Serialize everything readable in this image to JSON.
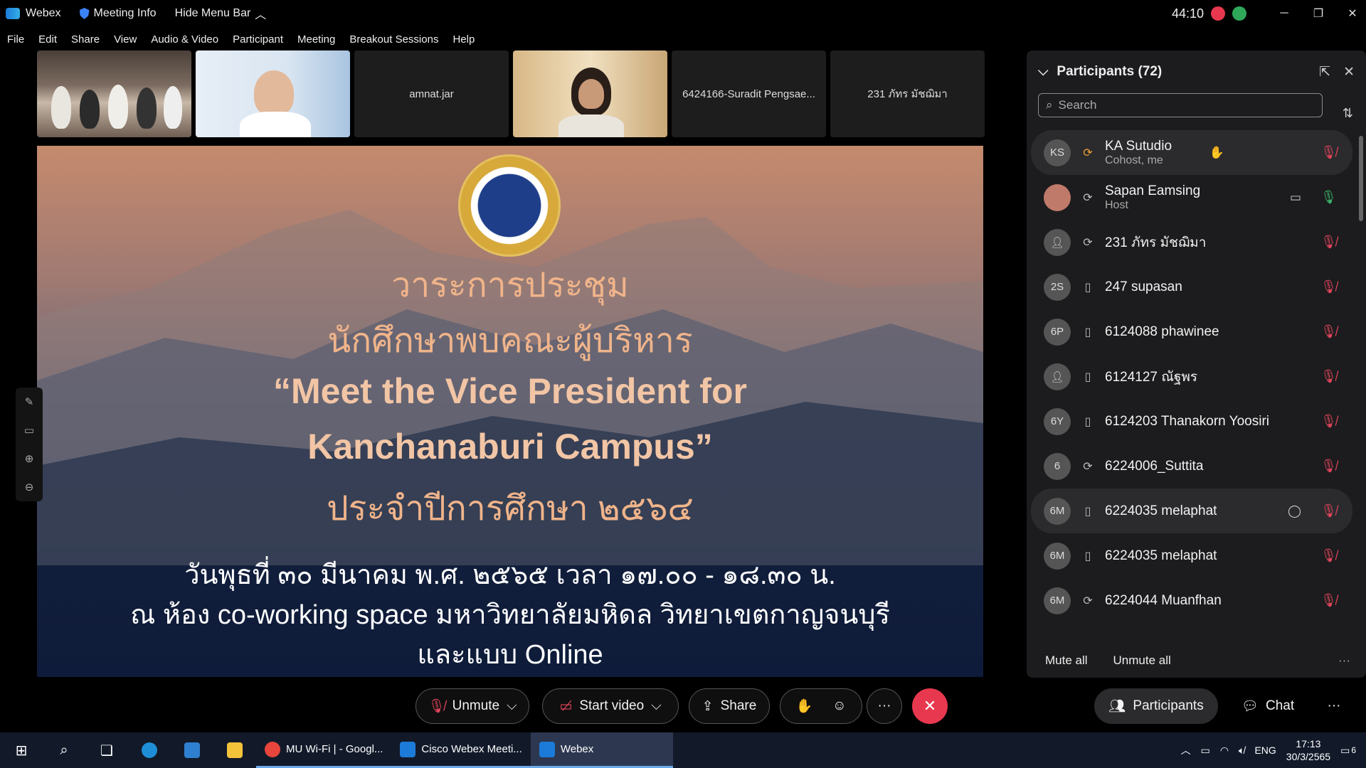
{
  "titlebar": {
    "app_name": "Webex",
    "meeting_info": "Meeting Info",
    "hide_menu_bar": "Hide Menu Bar",
    "timer": "44:10",
    "minimize": "─",
    "restore": "❐",
    "close": "✕"
  },
  "menubar": [
    "File",
    "Edit",
    "Share",
    "View",
    "Audio & Video",
    "Participant",
    "Meeting",
    "Breakout Sessions",
    "Help"
  ],
  "thumbnails": [
    {
      "label": ""
    },
    {
      "label": ""
    },
    {
      "label": "amnat.jar"
    },
    {
      "label": ""
    },
    {
      "label": "6424166-Suradit Pengsae..."
    },
    {
      "label": "231 ภัทร มัชฌิมา"
    }
  ],
  "slide": {
    "line1": "วาระการประชุม",
    "line2": "นักศึกษาพบคณะผู้บริหาร",
    "line3": "“Meet the Vice President for",
    "line4": "Kanchanaburi Campus”",
    "line5": "ประจำปีการศึกษา ๒๕๖๔",
    "line6": "วันพุธที่ ๓๐ มีนาคม พ.ศ. ๒๕๖๕ เวลา ๑๗.๐๐ - ๑๘.๓๐ น.",
    "line7": "ณ ห้อง co-working space มหาวิทยาลัยมหิดล วิทยาเขตกาญจนบุรี",
    "line8": "และแบบ Online"
  },
  "panel": {
    "title": "Participants (72)",
    "search_placeholder": "Search",
    "participants": [
      {
        "initials": "KS",
        "name": "KA Sutudio",
        "role": "Cohost, me",
        "type": "cohost",
        "mic": "muted",
        "extra": "hand"
      },
      {
        "initials": "",
        "name": "Sapan Eamsing",
        "role": "Host",
        "type": "app",
        "mic": "on",
        "extra": "video"
      },
      {
        "initials": "",
        "name": "231 ภัทร มัชฌิมา",
        "role": "",
        "type": "app",
        "mic": "muted",
        "extra": ""
      },
      {
        "initials": "2S",
        "name": "247 supasan",
        "role": "",
        "type": "mobile",
        "mic": "muted",
        "extra": ""
      },
      {
        "initials": "6P",
        "name": "6124088 phawinee",
        "role": "",
        "type": "mobile",
        "mic": "muted",
        "extra": ""
      },
      {
        "initials": "",
        "name": "6124127 ณัฐพร",
        "role": "",
        "type": "mobile",
        "mic": "muted",
        "extra": ""
      },
      {
        "initials": "6Y",
        "name": "6124203 Thanakorn Yoosiri",
        "role": "",
        "type": "mobile",
        "mic": "muted",
        "extra": ""
      },
      {
        "initials": "6",
        "name": "6224006_Suttita",
        "role": "",
        "type": "app",
        "mic": "muted",
        "extra": ""
      },
      {
        "initials": "6M",
        "name": "6224035 melaphat",
        "role": "",
        "type": "mobile",
        "mic": "muted",
        "extra": "chat"
      },
      {
        "initials": "6M",
        "name": "6224035 melaphat",
        "role": "",
        "type": "mobile",
        "mic": "muted",
        "extra": ""
      },
      {
        "initials": "6M",
        "name": "6224044 Muanfhan",
        "role": "",
        "type": "app",
        "mic": "muted",
        "extra": ""
      }
    ],
    "mute_all": "Mute all",
    "unmute_all": "Unmute all"
  },
  "controls": {
    "unmute": "Unmute",
    "start_video": "Start video",
    "share": "Share",
    "more": "···",
    "participants": "Participants",
    "chat": "Chat"
  },
  "taskbar": {
    "apps": [
      {
        "label": "MU Wi-Fi | - Googl...",
        "color": "#e8453c"
      },
      {
        "label": "Cisco Webex Meeti...",
        "color": "#1c7bd9"
      },
      {
        "label": "Webex",
        "color": "#1c7bd9"
      }
    ],
    "lang": "ENG",
    "time": "17:13",
    "date": "30/3/2565",
    "notif_count": "6"
  }
}
